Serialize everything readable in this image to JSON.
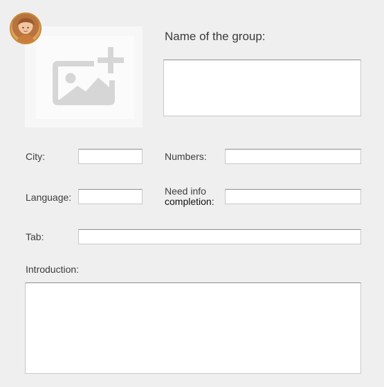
{
  "avatar": {
    "icon": "user-avatar"
  },
  "image_upload": {
    "icon": "add-image-icon"
  },
  "form": {
    "group_name_label": "Name of the group:",
    "group_name_value": "",
    "city_label": "City:",
    "city_value": "",
    "numbers_label": "Numbers:",
    "numbers_value": "",
    "language_label": "Language:",
    "language_value": "",
    "need_info_label_line1": "Need info",
    "need_info_label_line2": "completion:",
    "need_info_value": "",
    "tab_label": "Tab:",
    "tab_value": "",
    "introduction_label": "Introduction:",
    "introduction_value": ""
  }
}
